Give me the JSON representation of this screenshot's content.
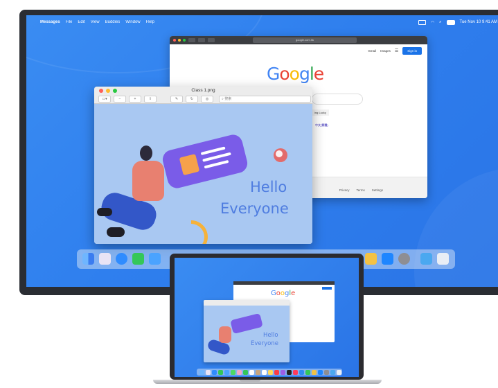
{
  "menubar": {
    "app": "Messages",
    "items": [
      "File",
      "Edit",
      "View",
      "Buddies",
      "Window",
      "Help"
    ],
    "datetime": "Tue Nov 10  9:41 AM"
  },
  "safari": {
    "url": "google.com.hk",
    "links": [
      "Gmail",
      "Images"
    ],
    "signin": "Sign in",
    "logo": "Google",
    "lucky": "ing Lucky",
    "language": "中文(繁體)",
    "footer_links": [
      "Privacy",
      "Terms",
      "Settings"
    ]
  },
  "preview": {
    "title": "Class 1.png",
    "search_placeholder": "搜索",
    "hello": "Hello",
    "everyone": "Everyone"
  },
  "laptop": {
    "logo": "Google",
    "hello": "Hello",
    "everyone": "Everyone"
  },
  "dock": {
    "icons": [
      "finder-icon",
      "launchpad-icon",
      "safari-icon",
      "messages-icon",
      "mail-icon",
      "maps-icon",
      "photos-icon",
      "facetime-icon",
      "calendar-icon",
      "contacts-icon",
      "reminders-icon",
      "notes-icon",
      "music-icon",
      "podcasts-icon",
      "tv-icon",
      "news-icon",
      "keynote-icon",
      "numbers-icon",
      "pages-icon",
      "app-store-icon",
      "system-preferences-icon",
      "downloads-folder-icon",
      "trash-icon"
    ]
  },
  "colors": {
    "desktop": "#2f7fee",
    "accent_blue": "#1a73e8",
    "card_purple": "#7a5ce8",
    "hello_text": "#4f7de0"
  }
}
